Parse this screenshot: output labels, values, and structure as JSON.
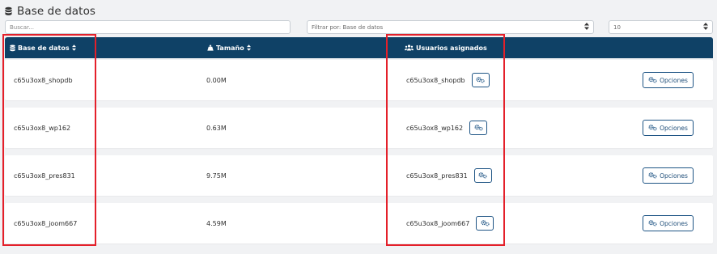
{
  "page": {
    "title": "Base de datos",
    "title_icon": "database-icon"
  },
  "filters": {
    "search_placeholder": "Buscar...",
    "filter_label": "Filtrar por: Base de datos",
    "per_page": "10"
  },
  "table": {
    "headers": {
      "database": "Base de datos",
      "size": "Tamaño",
      "users": "Usuarios asignados"
    },
    "options_label": "Opciones",
    "rows": [
      {
        "database": "c65u3ox8_shopdb",
        "size": "0.00M",
        "user": "c65u3ox8_shopdb"
      },
      {
        "database": "c65u3ox8_wp162",
        "size": "0.63M",
        "user": "c65u3ox8_wp162"
      },
      {
        "database": "c65u3ox8_pres831",
        "size": "9.75M",
        "user": "c65u3ox8_pres831"
      },
      {
        "database": "c65u3ox8_joom667",
        "size": "4.59M",
        "user": "c65u3ox8_joom667"
      }
    ]
  },
  "colors": {
    "header_bg": "#0f4166",
    "accent": "#1f5585",
    "highlight": "#e4202a"
  }
}
